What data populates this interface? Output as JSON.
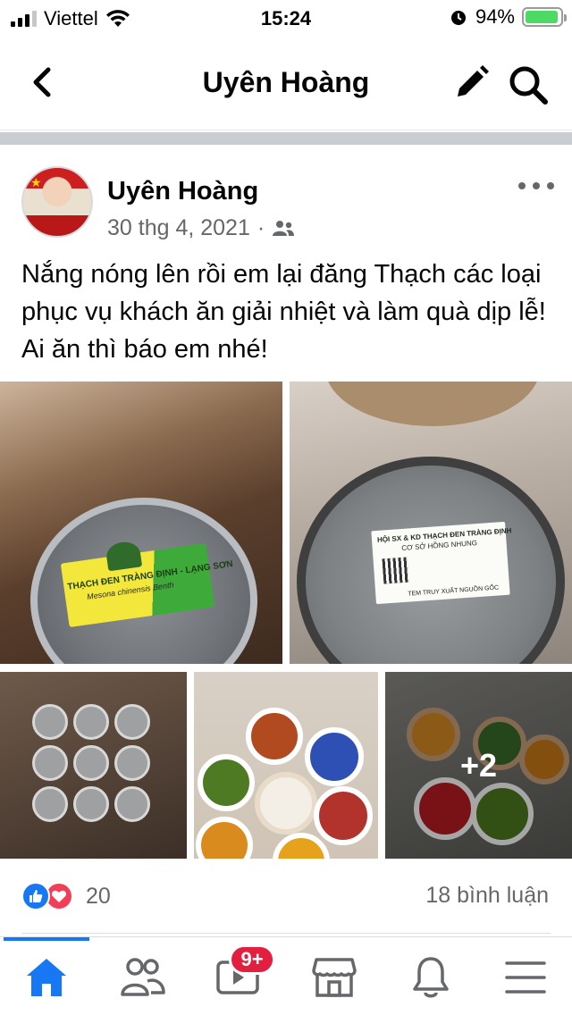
{
  "status_bar": {
    "carrier": "Viettel",
    "time": "15:24",
    "battery_percent": "94%",
    "battery_level": 0.94,
    "signal_bars": 3
  },
  "nav": {
    "title": "Uyên Hoàng",
    "back_icon": "chevron-left-icon",
    "edit_icon": "pencil-icon",
    "search_icon": "search-icon"
  },
  "post": {
    "author": "Uyên Hoàng",
    "date": "30 thg 4, 2021",
    "separator": "·",
    "audience_icon": "friends-icon",
    "text": "Nắng nóng lên rồi em lại đăng Thạch các loại phục vụ khách ăn giải nhiệt và làm quà dịp lễ! Ai ăn thì báo em nhé!",
    "photo1_label": {
      "line1": "THẠCH ĐEN TRÀNG ĐỊNH - LẠNG SƠN",
      "line2": "Mesona chinensis Benth"
    },
    "photo2_label": {
      "line1": "HỘI SX & KD THẠCH ĐEN TRÀNG ĐỊNH",
      "line2": "CƠ SỞ HỒNG NHUNG",
      "line3": "TEM TRUY XUẤT NGUỒN GỐC"
    },
    "more_photos": "+2",
    "reaction_count": "20",
    "comment_count": "18 bình luận"
  },
  "tab_bar": {
    "tabs": [
      "home-icon",
      "friends-icon",
      "watch-icon",
      "marketplace-icon",
      "notifications-icon",
      "menu-icon"
    ],
    "watch_badge": "9+",
    "active_color": "#1877f2"
  },
  "colors": {
    "like": "#1877f2",
    "love": "#f33e58",
    "badge": "#e41e3f",
    "secondary_text": "#65676b"
  }
}
